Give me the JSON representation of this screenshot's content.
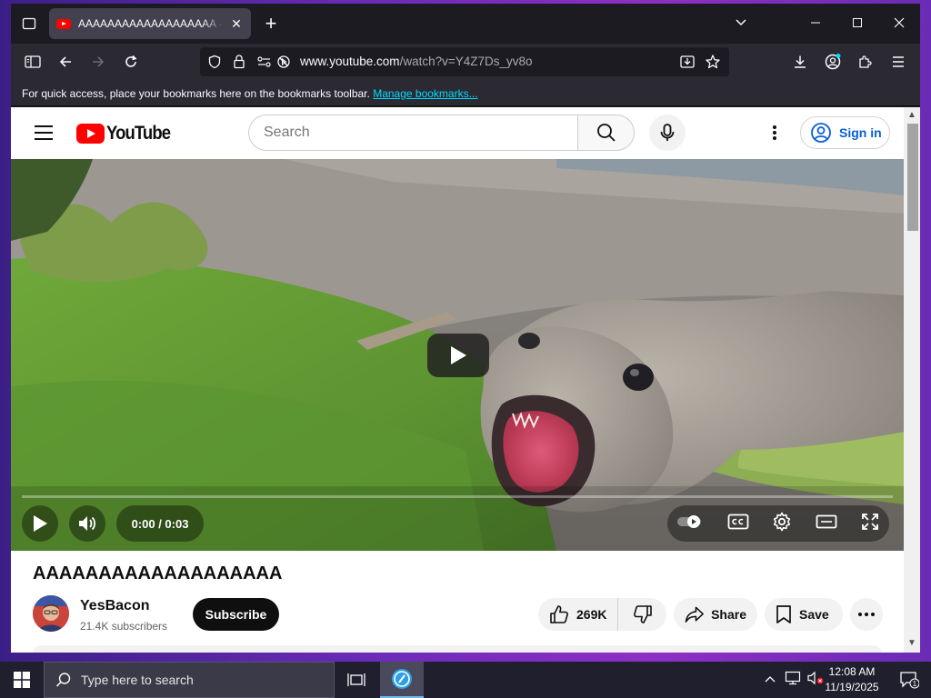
{
  "browser": {
    "tab_title": "AAAAAAAAAAAAAAAAAAA - YouTube",
    "tab_close": "✕",
    "new_tab": "+",
    "url_domain": "www.youtube.com",
    "url_path": "/watch?v=Y4Z7Ds_yv8o",
    "bookmarks_message": "For quick access, place your bookmarks here on the bookmarks toolbar.",
    "bookmarks_link": "Manage bookmarks..."
  },
  "youtube": {
    "logo_text": "YouTube",
    "search_placeholder": "Search",
    "sign_in_label": "Sign in",
    "player": {
      "time_display": "0:00 / 0:03",
      "progress": 0
    },
    "video": {
      "title": "AAAAAAAAAAAAAAAAAAA",
      "channel_name": "YesBacon",
      "subscribers": "21.4K subscribers",
      "subscribe_label": "Subscribe",
      "like_count": "269K",
      "share_label": "Share",
      "save_label": "Save"
    }
  },
  "taskbar": {
    "search_placeholder": "Type here to search",
    "time": "12:08 AM",
    "date": "11/19/2025",
    "notification_count": "1"
  },
  "colors": {
    "youtube_red": "#ff0000",
    "sign_in_blue": "#065fd4",
    "firefox_dark": "#1c1b22",
    "bookmark_link": "#00ddff"
  }
}
